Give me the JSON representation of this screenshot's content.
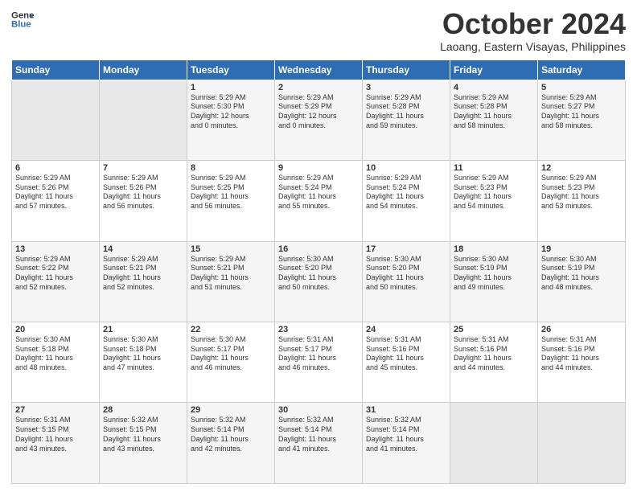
{
  "logo": {
    "line1": "General",
    "line2": "Blue"
  },
  "header": {
    "month": "October 2024",
    "location": "Laoang, Eastern Visayas, Philippines"
  },
  "weekdays": [
    "Sunday",
    "Monday",
    "Tuesday",
    "Wednesday",
    "Thursday",
    "Friday",
    "Saturday"
  ],
  "weeks": [
    [
      {
        "day": "",
        "text": ""
      },
      {
        "day": "",
        "text": ""
      },
      {
        "day": "1",
        "text": "Sunrise: 5:29 AM\nSunset: 5:30 PM\nDaylight: 12 hours\nand 0 minutes."
      },
      {
        "day": "2",
        "text": "Sunrise: 5:29 AM\nSunset: 5:29 PM\nDaylight: 12 hours\nand 0 minutes."
      },
      {
        "day": "3",
        "text": "Sunrise: 5:29 AM\nSunset: 5:28 PM\nDaylight: 11 hours\nand 59 minutes."
      },
      {
        "day": "4",
        "text": "Sunrise: 5:29 AM\nSunset: 5:28 PM\nDaylight: 11 hours\nand 58 minutes."
      },
      {
        "day": "5",
        "text": "Sunrise: 5:29 AM\nSunset: 5:27 PM\nDaylight: 11 hours\nand 58 minutes."
      }
    ],
    [
      {
        "day": "6",
        "text": "Sunrise: 5:29 AM\nSunset: 5:26 PM\nDaylight: 11 hours\nand 57 minutes."
      },
      {
        "day": "7",
        "text": "Sunrise: 5:29 AM\nSunset: 5:26 PM\nDaylight: 11 hours\nand 56 minutes."
      },
      {
        "day": "8",
        "text": "Sunrise: 5:29 AM\nSunset: 5:25 PM\nDaylight: 11 hours\nand 56 minutes."
      },
      {
        "day": "9",
        "text": "Sunrise: 5:29 AM\nSunset: 5:24 PM\nDaylight: 11 hours\nand 55 minutes."
      },
      {
        "day": "10",
        "text": "Sunrise: 5:29 AM\nSunset: 5:24 PM\nDaylight: 11 hours\nand 54 minutes."
      },
      {
        "day": "11",
        "text": "Sunrise: 5:29 AM\nSunset: 5:23 PM\nDaylight: 11 hours\nand 54 minutes."
      },
      {
        "day": "12",
        "text": "Sunrise: 5:29 AM\nSunset: 5:23 PM\nDaylight: 11 hours\nand 53 minutes."
      }
    ],
    [
      {
        "day": "13",
        "text": "Sunrise: 5:29 AM\nSunset: 5:22 PM\nDaylight: 11 hours\nand 52 minutes."
      },
      {
        "day": "14",
        "text": "Sunrise: 5:29 AM\nSunset: 5:21 PM\nDaylight: 11 hours\nand 52 minutes."
      },
      {
        "day": "15",
        "text": "Sunrise: 5:29 AM\nSunset: 5:21 PM\nDaylight: 11 hours\nand 51 minutes."
      },
      {
        "day": "16",
        "text": "Sunrise: 5:30 AM\nSunset: 5:20 PM\nDaylight: 11 hours\nand 50 minutes."
      },
      {
        "day": "17",
        "text": "Sunrise: 5:30 AM\nSunset: 5:20 PM\nDaylight: 11 hours\nand 50 minutes."
      },
      {
        "day": "18",
        "text": "Sunrise: 5:30 AM\nSunset: 5:19 PM\nDaylight: 11 hours\nand 49 minutes."
      },
      {
        "day": "19",
        "text": "Sunrise: 5:30 AM\nSunset: 5:19 PM\nDaylight: 11 hours\nand 48 minutes."
      }
    ],
    [
      {
        "day": "20",
        "text": "Sunrise: 5:30 AM\nSunset: 5:18 PM\nDaylight: 11 hours\nand 48 minutes."
      },
      {
        "day": "21",
        "text": "Sunrise: 5:30 AM\nSunset: 5:18 PM\nDaylight: 11 hours\nand 47 minutes."
      },
      {
        "day": "22",
        "text": "Sunrise: 5:30 AM\nSunset: 5:17 PM\nDaylight: 11 hours\nand 46 minutes."
      },
      {
        "day": "23",
        "text": "Sunrise: 5:31 AM\nSunset: 5:17 PM\nDaylight: 11 hours\nand 46 minutes."
      },
      {
        "day": "24",
        "text": "Sunrise: 5:31 AM\nSunset: 5:16 PM\nDaylight: 11 hours\nand 45 minutes."
      },
      {
        "day": "25",
        "text": "Sunrise: 5:31 AM\nSunset: 5:16 PM\nDaylight: 11 hours\nand 44 minutes."
      },
      {
        "day": "26",
        "text": "Sunrise: 5:31 AM\nSunset: 5:16 PM\nDaylight: 11 hours\nand 44 minutes."
      }
    ],
    [
      {
        "day": "27",
        "text": "Sunrise: 5:31 AM\nSunset: 5:15 PM\nDaylight: 11 hours\nand 43 minutes."
      },
      {
        "day": "28",
        "text": "Sunrise: 5:32 AM\nSunset: 5:15 PM\nDaylight: 11 hours\nand 43 minutes."
      },
      {
        "day": "29",
        "text": "Sunrise: 5:32 AM\nSunset: 5:14 PM\nDaylight: 11 hours\nand 42 minutes."
      },
      {
        "day": "30",
        "text": "Sunrise: 5:32 AM\nSunset: 5:14 PM\nDaylight: 11 hours\nand 41 minutes."
      },
      {
        "day": "31",
        "text": "Sunrise: 5:32 AM\nSunset: 5:14 PM\nDaylight: 11 hours\nand 41 minutes."
      },
      {
        "day": "",
        "text": ""
      },
      {
        "day": "",
        "text": ""
      }
    ]
  ]
}
